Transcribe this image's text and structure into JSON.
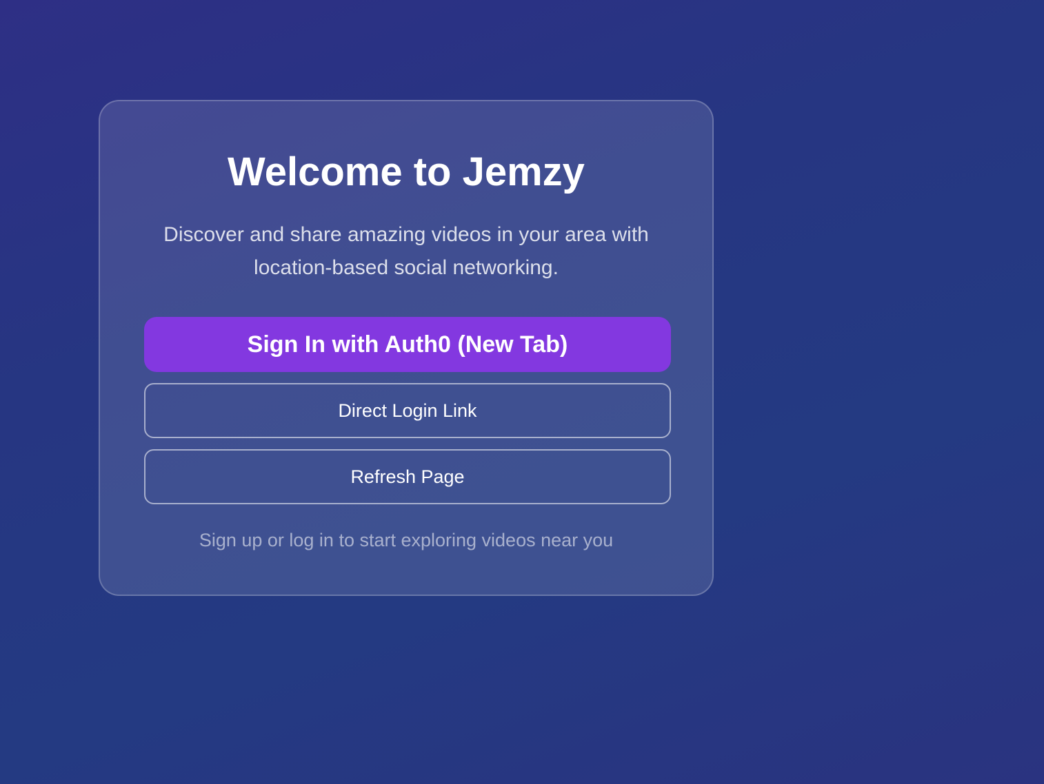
{
  "welcome": {
    "title": "Welcome to Jemzy",
    "subtitle": "Discover and share amazing videos in your area with location-based social networking.",
    "primary_button_label": "Sign In with Auth0 (New Tab)",
    "direct_login_label": "Direct Login Link",
    "refresh_label": "Refresh Page",
    "footnote": "Sign up or log in to start exploring videos near you"
  },
  "colors": {
    "primary_button": "#8338e0",
    "background": "#263682"
  }
}
